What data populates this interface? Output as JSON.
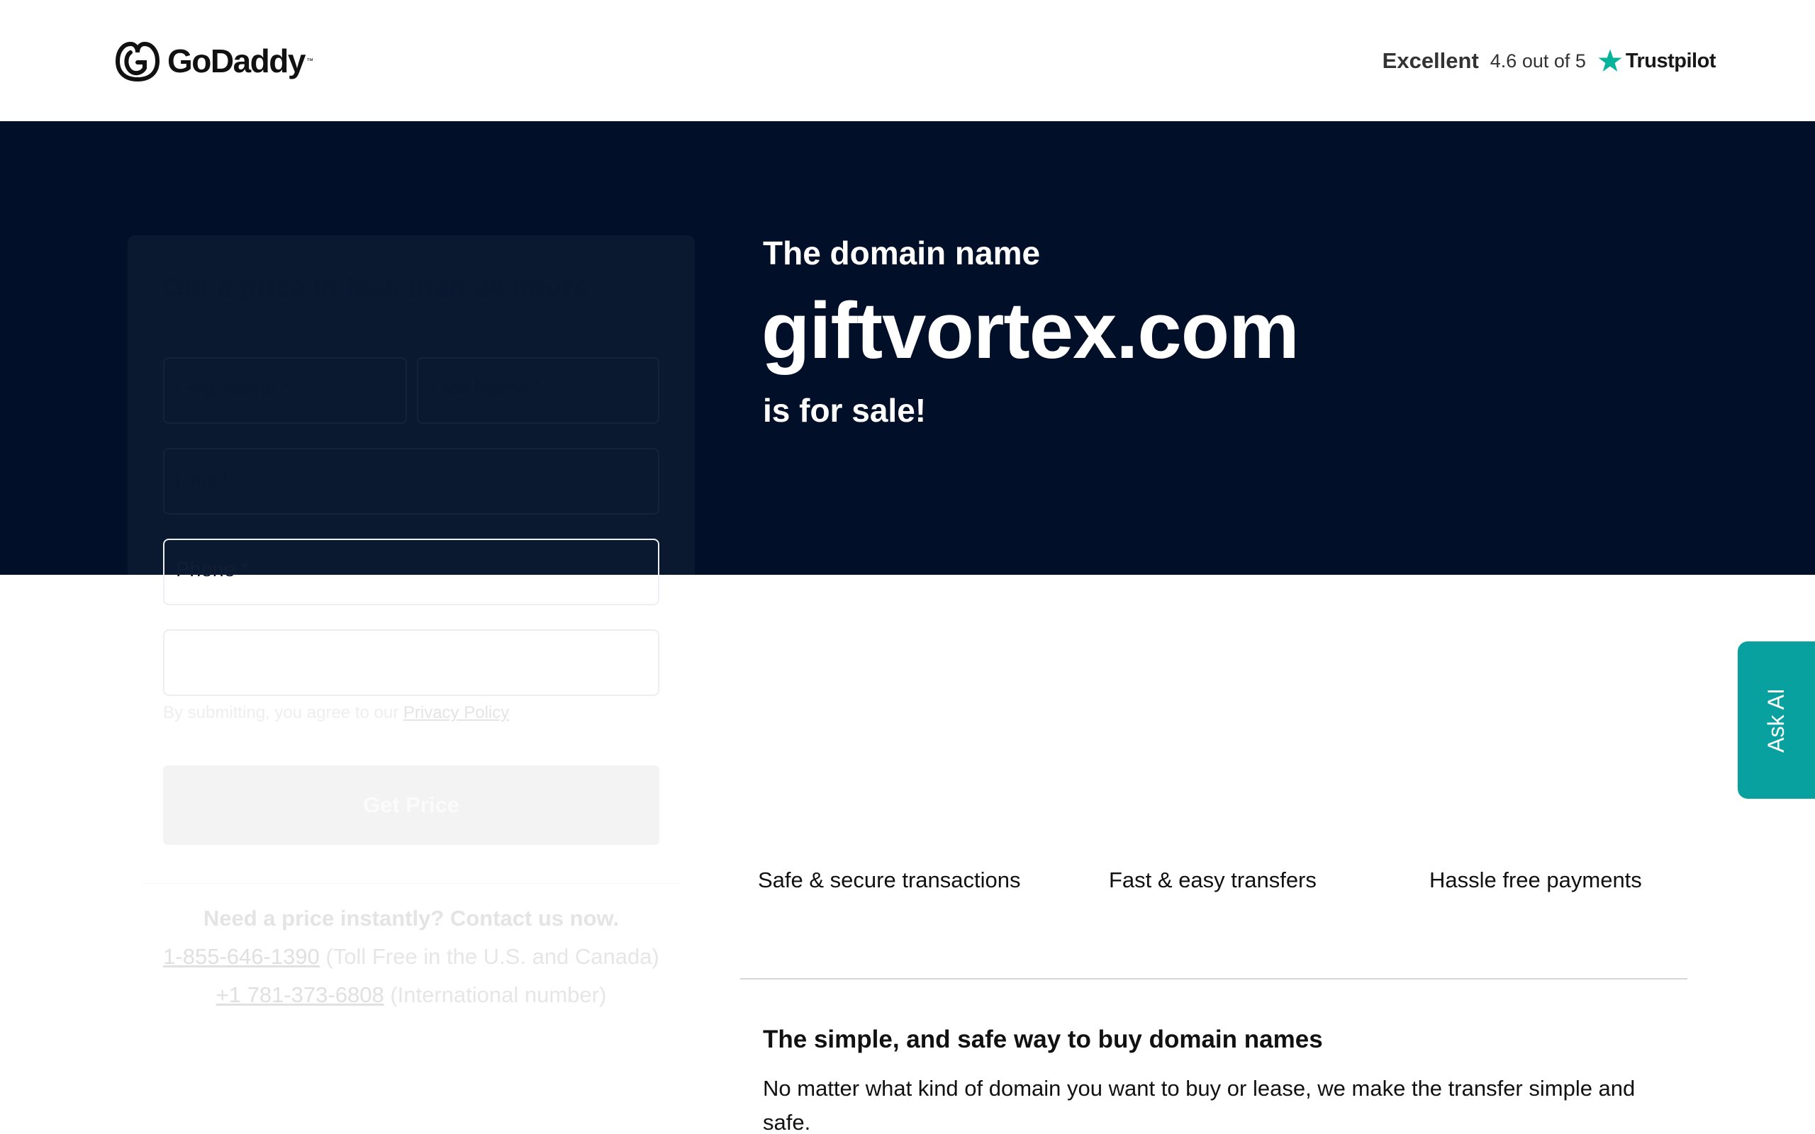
{
  "header": {
    "brand": "GoDaddy",
    "rating_word": "Excellent",
    "rating_score": "4.6 out of 5",
    "review_site": "Trustpilot"
  },
  "hero": {
    "title": "The domain name",
    "domain": "giftvortex.com",
    "subtitle": "is for sale!"
  },
  "form": {
    "title": "Get a price in less than 24 hours",
    "first_name": "First Name *",
    "last_name": "Last Name *",
    "email": "Email *",
    "phone": "Phone *",
    "agree_text": "By submitting, you agree to our",
    "privacy_link": "Privacy Policy",
    "submit": "Get Price"
  },
  "contact": {
    "title": "Need a price instantly? Contact us now.",
    "tollfree_number": "1-855-646-1390",
    "tollfree_note": "(Toll Free in the U.S. and Canada)",
    "intl_number": "+1 781-373-6808",
    "intl_note": "(International number)"
  },
  "features": [
    "Safe & secure transactions",
    "Fast & easy transfers",
    "Hassle free payments"
  ],
  "section": {
    "title": "The simple, and safe way to buy domain names",
    "body": "No matter what kind of domain you want to buy or lease, we make the transfer simple and safe."
  },
  "ask_ai": "Ask AI",
  "colors": {
    "hero_bg": "#010f28",
    "accent_teal": "#09a1a0",
    "trustpilot_star": "#04b39a"
  }
}
